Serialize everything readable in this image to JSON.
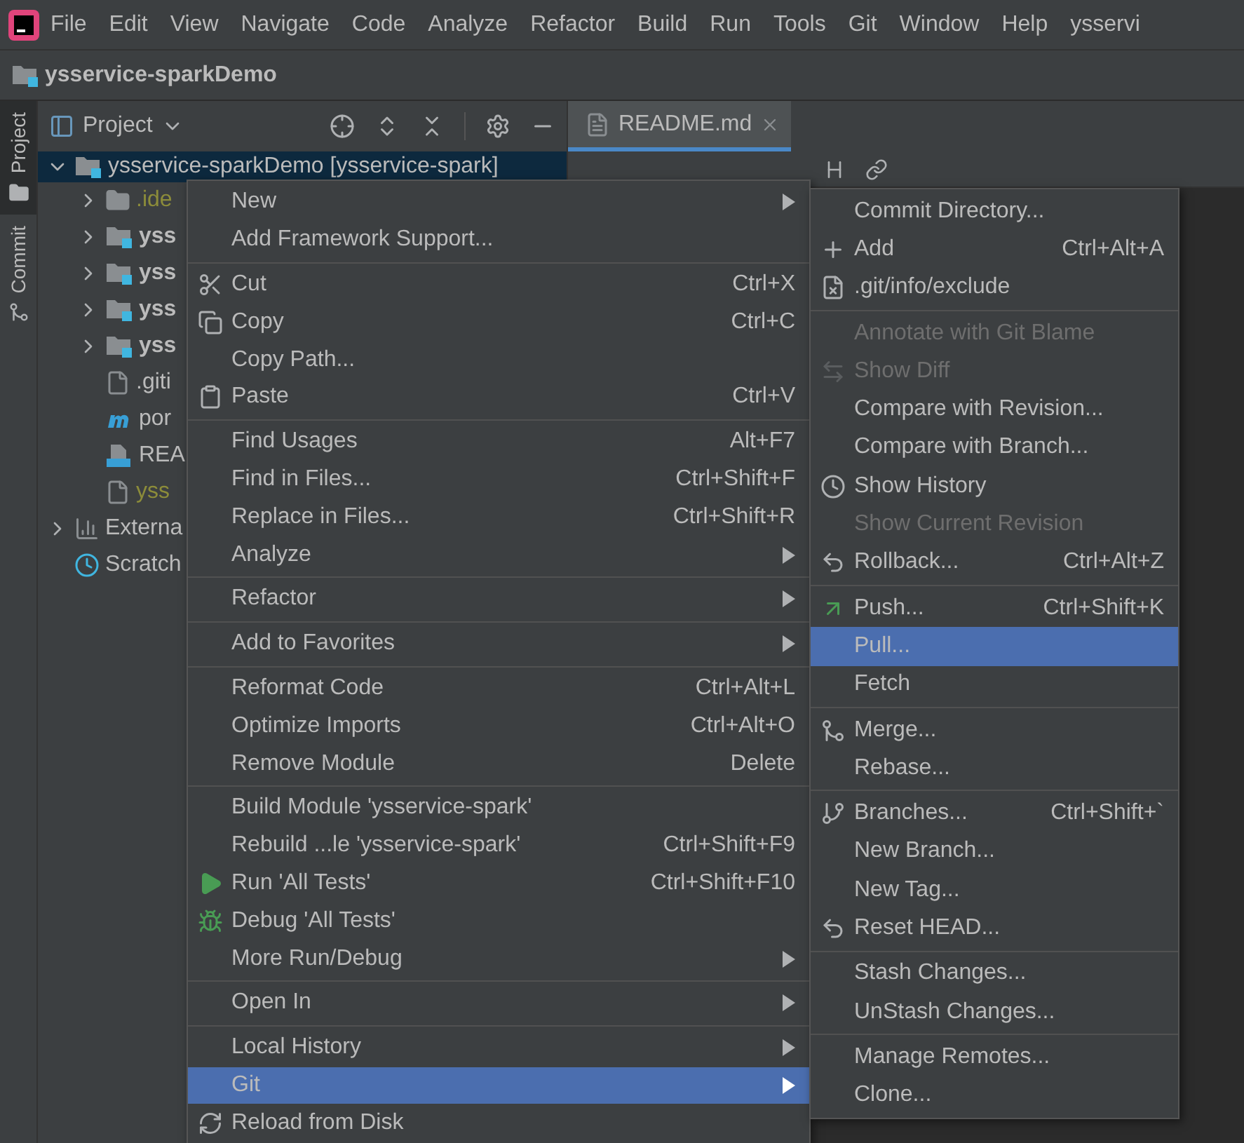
{
  "menu_bar": {
    "items": [
      {
        "label": "File"
      },
      {
        "label": "Edit"
      },
      {
        "label": "View"
      },
      {
        "label": "Navigate"
      },
      {
        "label": "Code"
      },
      {
        "label": "Analyze"
      },
      {
        "label": "Refactor"
      },
      {
        "label": "Build"
      },
      {
        "label": "Run"
      },
      {
        "label": "Tools"
      },
      {
        "label": "Git"
      },
      {
        "label": "Window"
      },
      {
        "label": "Help"
      }
    ],
    "window_title": "ysservi"
  },
  "nav_bar": {
    "project": "ysservice-sparkDemo"
  },
  "tool_stripe": {
    "tabs": [
      {
        "label": "Project",
        "selected": true
      },
      {
        "label": "Commit",
        "selected": false
      }
    ]
  },
  "project_panel": {
    "title": "Project",
    "tree": [
      {
        "label": "ysservice-sparkDemo [ysservice-spark]",
        "kind": "module",
        "ignored": false,
        "expanded": true,
        "selected": true,
        "children": [
          {
            "label": ".ide",
            "kind": "folder",
            "ignored": true,
            "expanded": false,
            "selected": false
          },
          {
            "label": "yss",
            "kind": "module",
            "ignored": false,
            "expanded": false,
            "selected": false
          },
          {
            "label": "yss",
            "kind": "module",
            "ignored": false,
            "expanded": false,
            "selected": false
          },
          {
            "label": "yss",
            "kind": "module",
            "ignored": false,
            "expanded": false,
            "selected": false
          },
          {
            "label": "yss",
            "kind": "module",
            "ignored": false,
            "expanded": false,
            "selected": false
          },
          {
            "label": ".giti",
            "kind": "file",
            "ignored": false,
            "selected": false
          },
          {
            "label": "por",
            "kind": "maven",
            "ignored": false,
            "selected": false
          },
          {
            "label": "REA",
            "kind": "markdown",
            "ignored": false,
            "selected": false
          },
          {
            "label": "yss",
            "kind": "file",
            "ignored": true,
            "selected": false
          }
        ]
      },
      {
        "label": "Externa",
        "kind": "library",
        "ignored": false,
        "expanded": false,
        "selected": false
      },
      {
        "label": "Scratch",
        "kind": "scratch",
        "ignored": false,
        "selected": false
      }
    ]
  },
  "editor": {
    "tabs": [
      {
        "label": "README.md",
        "selected": true
      }
    ]
  },
  "context_menu": {
    "groups": [
      [
        {
          "label": "New",
          "submenu": true,
          "selected": false
        },
        {
          "label": "Add Framework Support...",
          "selected": false
        }
      ],
      [
        {
          "label": "Cut",
          "shortcut": "Ctrl+X",
          "selected": false
        },
        {
          "label": "Copy",
          "shortcut": "Ctrl+C",
          "selected": false
        },
        {
          "label": "Copy Path...",
          "selected": false
        },
        {
          "label": "Paste",
          "shortcut": "Ctrl+V",
          "selected": false
        }
      ],
      [
        {
          "label": "Find Usages",
          "shortcut": "Alt+F7",
          "selected": false
        },
        {
          "label": "Find in Files...",
          "shortcut": "Ctrl+Shift+F",
          "selected": false
        },
        {
          "label": "Replace in Files...",
          "shortcut": "Ctrl+Shift+R",
          "selected": false
        },
        {
          "label": "Analyze",
          "submenu": true,
          "selected": false
        }
      ],
      [
        {
          "label": "Refactor",
          "submenu": true,
          "selected": false
        }
      ],
      [
        {
          "label": "Add to Favorites",
          "submenu": true,
          "selected": false
        }
      ],
      [
        {
          "label": "Reformat Code",
          "shortcut": "Ctrl+Alt+L",
          "selected": false
        },
        {
          "label": "Optimize Imports",
          "shortcut": "Ctrl+Alt+O",
          "selected": false
        },
        {
          "label": "Remove Module",
          "shortcut": "Delete",
          "selected": false
        }
      ],
      [
        {
          "label": "Build Module 'ysservice-spark'",
          "selected": false
        },
        {
          "label": "Rebuild ...le 'ysservice-spark'",
          "shortcut": "Ctrl+Shift+F9",
          "selected": false
        },
        {
          "label": "Run 'All Tests'",
          "shortcut": "Ctrl+Shift+F10",
          "selected": false
        },
        {
          "label": "Debug 'All Tests'",
          "selected": false
        },
        {
          "label": "More Run/Debug",
          "submenu": true,
          "selected": false
        }
      ],
      [
        {
          "label": "Open In",
          "submenu": true,
          "selected": false
        }
      ],
      [
        {
          "label": "Local History",
          "submenu": true,
          "selected": false
        },
        {
          "label": "Git",
          "submenu": true,
          "selected": true
        },
        {
          "label": "Reload from Disk",
          "selected": false
        }
      ]
    ]
  },
  "git_submenu": {
    "groups": [
      [
        {
          "label": "Commit Directory...",
          "disabled": false,
          "selected": false
        },
        {
          "label": "Add",
          "shortcut": "Ctrl+Alt+A",
          "disabled": false,
          "selected": false
        },
        {
          "label": ".git/info/exclude",
          "disabled": false,
          "selected": false
        }
      ],
      [
        {
          "label": "Annotate with Git Blame",
          "disabled": true,
          "selected": false
        },
        {
          "label": "Show Diff",
          "disabled": true,
          "selected": false
        },
        {
          "label": "Compare with Revision...",
          "disabled": false,
          "selected": false
        },
        {
          "label": "Compare with Branch...",
          "disabled": false,
          "selected": false
        },
        {
          "label": "Show History",
          "disabled": false,
          "selected": false
        },
        {
          "label": "Show Current Revision",
          "disabled": true,
          "selected": false
        },
        {
          "label": "Rollback...",
          "shortcut": "Ctrl+Alt+Z",
          "disabled": false,
          "selected": false
        }
      ],
      [
        {
          "label": "Push...",
          "shortcut": "Ctrl+Shift+K",
          "disabled": false,
          "selected": false
        },
        {
          "label": "Pull...",
          "disabled": false,
          "selected": true
        },
        {
          "label": "Fetch",
          "disabled": false,
          "selected": false
        }
      ],
      [
        {
          "label": "Merge...",
          "disabled": false,
          "selected": false
        },
        {
          "label": "Rebase...",
          "disabled": false,
          "selected": false
        }
      ],
      [
        {
          "label": "Branches...",
          "shortcut": "Ctrl+Shift+`",
          "disabled": false,
          "selected": false
        },
        {
          "label": "New Branch...",
          "disabled": false,
          "selected": false
        },
        {
          "label": "New Tag...",
          "disabled": false,
          "selected": false
        },
        {
          "label": "Reset HEAD...",
          "disabled": false,
          "selected": false
        }
      ],
      [
        {
          "label": "Stash Changes...",
          "disabled": false,
          "selected": false
        },
        {
          "label": "UnStash Changes...",
          "disabled": false,
          "selected": false
        }
      ],
      [
        {
          "label": "Manage Remotes...",
          "disabled": false,
          "selected": false
        },
        {
          "label": "Clone...",
          "disabled": false,
          "selected": false
        }
      ]
    ]
  }
}
